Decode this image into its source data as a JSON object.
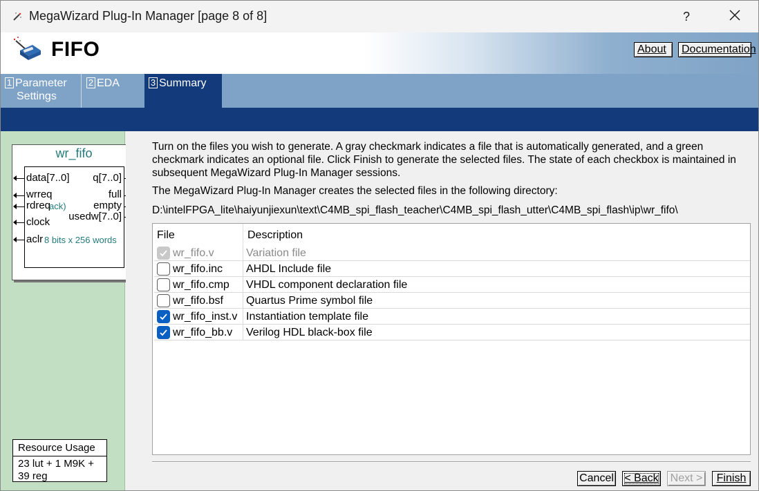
{
  "window": {
    "title": "MegaWizard Plug-In Manager [page 8 of 8]",
    "help_label": "?"
  },
  "header": {
    "title": "FIFO",
    "about_label": "About",
    "documentation_label": "Documentation"
  },
  "tabs": [
    {
      "num": "1",
      "line1": "Parameter",
      "line2": "Settings",
      "active": false
    },
    {
      "num": "2",
      "line1": "EDA",
      "active": false
    },
    {
      "num": "3",
      "line1": "Summary",
      "active": true
    }
  ],
  "symbol": {
    "name": "wr_fifo",
    "pins": {
      "data": "data[7..0]",
      "q": "q[7..0]",
      "wrreq": "wrreq",
      "full": "full",
      "rdreq": "rdreq",
      "ack": "ack)",
      "empty": "empty",
      "clock": "clock",
      "usedw": "usedw[7..0]",
      "aclr": "aclr"
    },
    "info": "8 bits x 256 words"
  },
  "resource": {
    "title": "Resource Usage",
    "line1": "23 lut + 1 M9K +",
    "line2": "39 reg"
  },
  "main": {
    "intro": "Turn on the files you wish to generate. A gray checkmark indicates a file that is automatically generated, and a green checkmark indicates an optional file. Click Finish to generate the selected files. The state of each checkbox is maintained in subsequent MegaWizard Plug-In Manager sessions.",
    "dir_label": "The MegaWizard Plug-In Manager creates the selected files in the following directory:",
    "dir_path": "D:\\intelFPGA_lite\\haiyunjiexun\\text\\C4MB_spi_flash_teacher\\C4MB_spi_flash_utter\\C4MB_spi_flash\\ip\\wr_fifo\\"
  },
  "table": {
    "col_file": "File",
    "col_desc": "Description",
    "rows": [
      {
        "file": "wr_fifo.v",
        "desc": "Variation file",
        "checked": true,
        "disabled": true
      },
      {
        "file": "wr_fifo.inc",
        "desc": "AHDL Include file",
        "checked": false,
        "disabled": false
      },
      {
        "file": "wr_fifo.cmp",
        "desc": "VHDL component declaration file",
        "checked": false,
        "disabled": false
      },
      {
        "file": "wr_fifo.bsf",
        "desc": "Quartus Prime symbol file",
        "checked": false,
        "disabled": false
      },
      {
        "file": "wr_fifo_inst.v",
        "desc": "Instantiation template file",
        "checked": true,
        "disabled": false
      },
      {
        "file": "wr_fifo_bb.v",
        "desc": "Verilog HDL black-box file",
        "checked": true,
        "disabled": false
      }
    ]
  },
  "buttons": {
    "cancel": "Cancel",
    "back": "< Back",
    "next": "Next >",
    "finish": "Finish"
  },
  "colors": {
    "accent": "#133a7a",
    "tab_inactive": "#7fa3c6",
    "left_panel": "#c3dfc3",
    "checkbox_checked": "#0a5fc2"
  }
}
